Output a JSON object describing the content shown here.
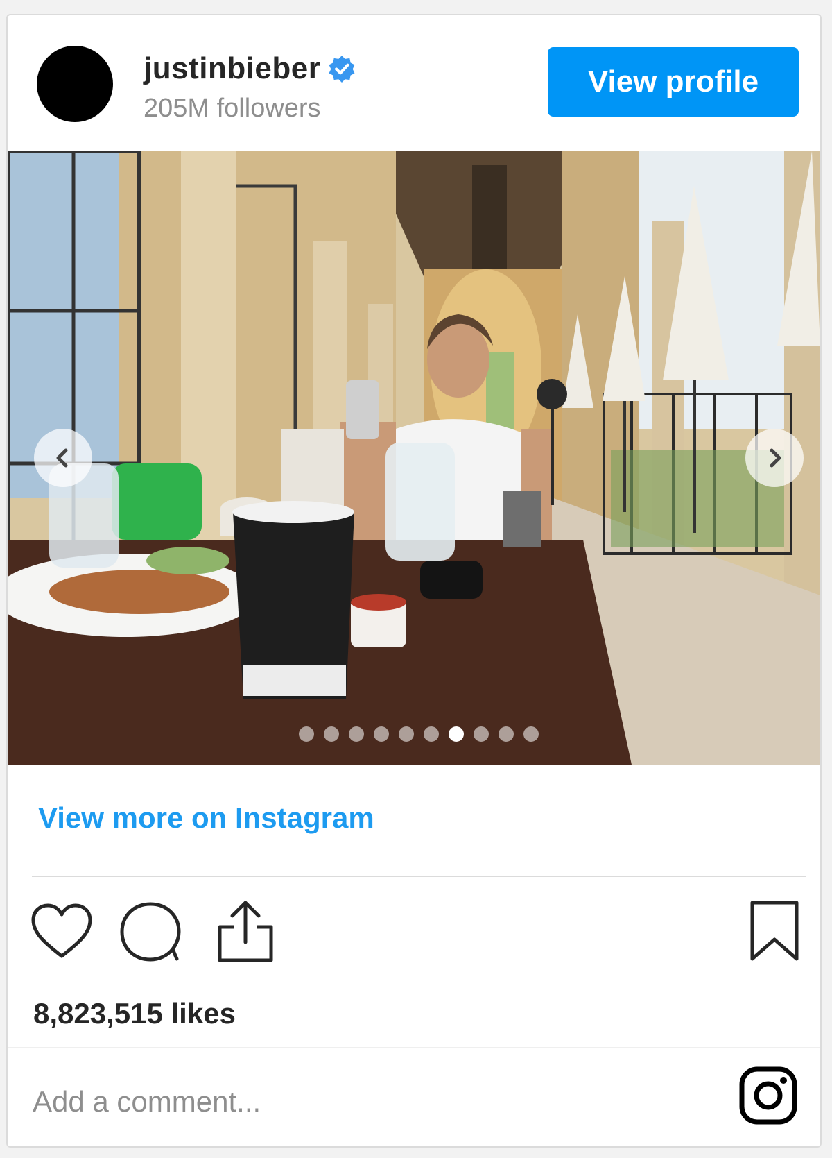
{
  "header": {
    "username": "justinbieber",
    "followers": "205M followers",
    "view_profile_label": "View profile"
  },
  "media": {
    "slide_count": 10,
    "active_slide_index": 6
  },
  "view_more_label": "View more on Instagram",
  "likes": "8,823,515 likes",
  "comment_placeholder": "Add a comment...",
  "colors": {
    "accent_blue": "#0095f6",
    "link_blue": "#1d9bf0",
    "text_primary": "#262626",
    "text_secondary": "#8e8e8e"
  },
  "icons": {
    "verified": "verified-badge-icon",
    "prev": "chevron-left-icon",
    "next": "chevron-right-icon",
    "like": "heart-icon",
    "comment": "comment-bubble-icon",
    "share": "share-icon",
    "save": "bookmark-icon",
    "brand": "instagram-icon"
  }
}
